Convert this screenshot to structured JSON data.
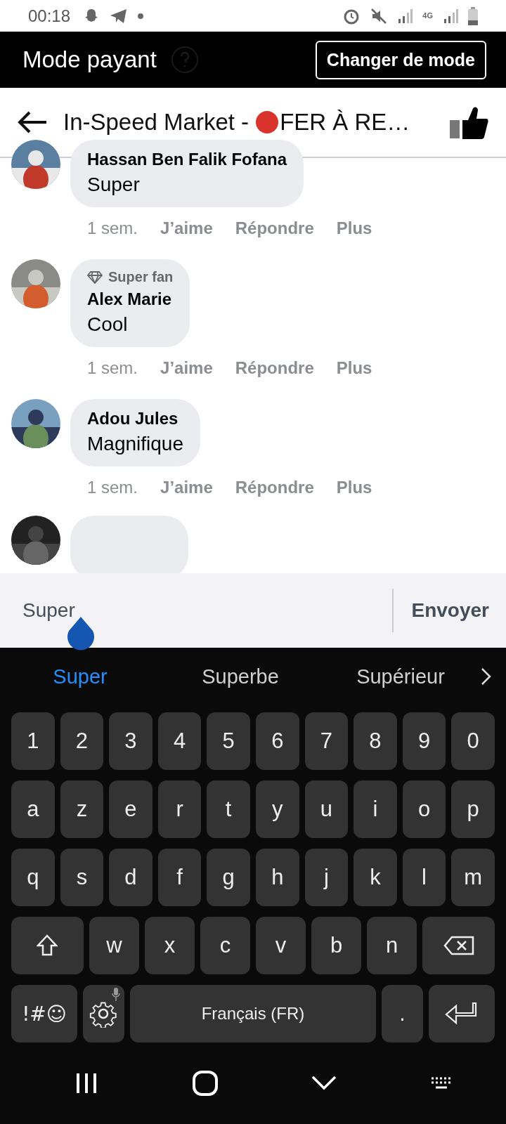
{
  "status_bar": {
    "time": "00:18",
    "network": "4G"
  },
  "mode_bar": {
    "title": "Mode payant",
    "button": "Changer de mode"
  },
  "header": {
    "title_start": "In-Speed Market -",
    "title_end": "FER À RE…"
  },
  "comments": [
    {
      "kind": "full",
      "name": "Hassan Ben Falik Fofana",
      "text": "Super",
      "time": "1 sem.",
      "actions": [
        "J’aime",
        "Répondre",
        "Plus"
      ]
    },
    {
      "kind": "full",
      "badge": "Super fan",
      "name": "Alex Marie",
      "text": "Cool",
      "time": "1 sem.",
      "actions": [
        "J’aime",
        "Répondre",
        "Plus"
      ]
    },
    {
      "kind": "full",
      "name": "Adou Jules",
      "text": "Magnifique",
      "time": "1 sem.",
      "actions": [
        "J’aime",
        "Répondre",
        "Plus"
      ]
    },
    {
      "kind": "partial"
    }
  ],
  "composer": {
    "value": "Super",
    "send": "Envoyer"
  },
  "keyboard": {
    "suggestions": [
      {
        "label": "Super",
        "selected": true
      },
      {
        "label": "Superbe",
        "selected": false
      },
      {
        "label": "Supérieur",
        "selected": false
      }
    ],
    "number_row": [
      "1",
      "2",
      "3",
      "4",
      "5",
      "6",
      "7",
      "8",
      "9",
      "0"
    ],
    "row_1": [
      "a",
      "z",
      "e",
      "r",
      "t",
      "y",
      "u",
      "i",
      "o",
      "p"
    ],
    "row_2": [
      "q",
      "s",
      "d",
      "f",
      "g",
      "h",
      "j",
      "k",
      "l",
      "m"
    ],
    "row_3": [
      "w",
      "x",
      "c",
      "v",
      "b",
      "n"
    ],
    "symbols": "!#☺",
    "space": "Français (FR)",
    "period": "."
  }
}
